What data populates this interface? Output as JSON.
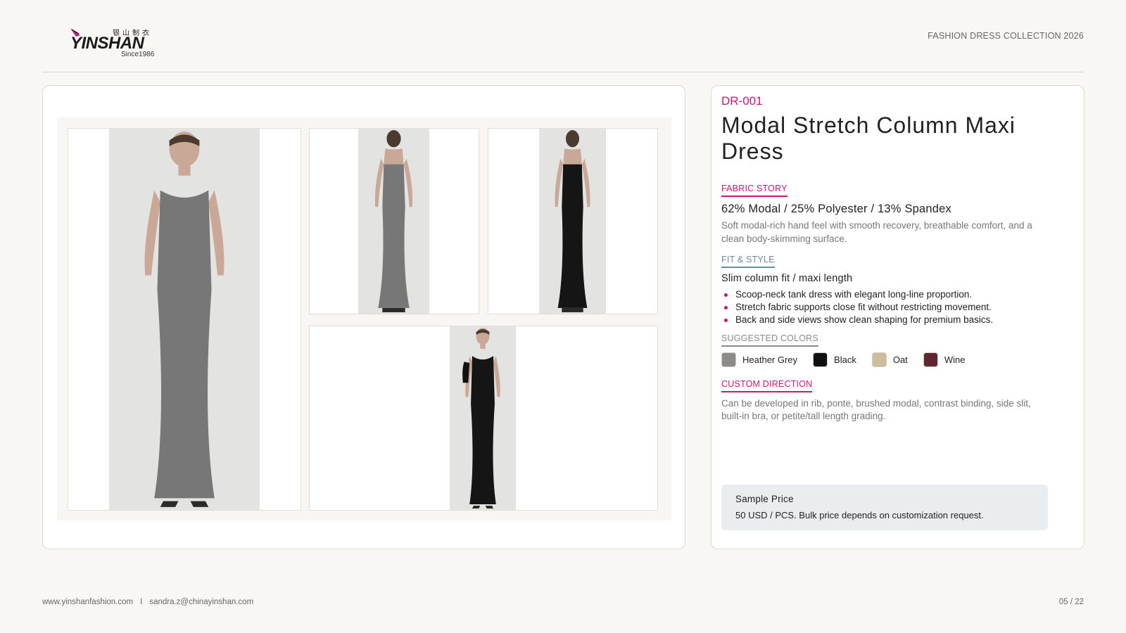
{
  "brand": {
    "name": "YINSHAN",
    "tagline_cn": "银山制衣",
    "since": "Since1986"
  },
  "header": {
    "collection": "FASHION DRESS COLLECTION 2026"
  },
  "gallery": {
    "photos": [
      {
        "view": "front",
        "color": "Heather Grey"
      },
      {
        "view": "back",
        "color": "Heather Grey"
      },
      {
        "view": "back",
        "color": "Black"
      },
      {
        "view": "front",
        "color": "Black"
      }
    ]
  },
  "product": {
    "code": "DR-001",
    "title": "Modal Stretch Column Maxi Dress",
    "fabric_story": {
      "label": "FABRIC STORY",
      "composition": "62% Modal / 25% Polyester / 13% Spandex",
      "description": "Soft modal-rich hand feel with smooth recovery, breathable comfort, and a clean body-skimming surface."
    },
    "fit_style": {
      "label": "FIT & STYLE",
      "headline": "Slim column fit / maxi length",
      "bullets": [
        "Scoop-neck tank dress with elegant long-line proportion.",
        "Stretch fabric supports close fit without restricting movement.",
        "Back and side views show clean shaping for premium basics."
      ]
    },
    "colors": {
      "label": "SUGGESTED COLORS",
      "items": [
        {
          "name": "Heather Grey",
          "hex": "#8d8b88"
        },
        {
          "name": "Black",
          "hex": "#111111"
        },
        {
          "name": "Oat",
          "hex": "#cdbd9c"
        },
        {
          "name": "Wine",
          "hex": "#5e2733"
        }
      ]
    },
    "custom": {
      "label": "CUSTOM DIRECTION",
      "description": "Can be developed in rib, ponte, brushed modal, contrast binding, side slit, built-in bra, or petite/tall length grading."
    },
    "price": {
      "label": "Sample Price",
      "text": "50 USD / PCS. Bulk price depends on customization request."
    }
  },
  "footer": {
    "website": "www.yinshanfashion.com",
    "separator": "I",
    "email": "sandra.z@chinayinshan.com",
    "page": "05 / 22"
  },
  "accent_color": "#c4177a"
}
